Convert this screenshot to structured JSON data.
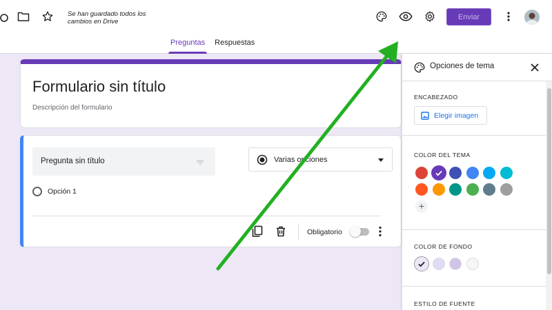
{
  "header": {
    "save_status": "Se han guardado todos los cambios en Drive",
    "send_label": "Enviar"
  },
  "tabs": [
    {
      "label": "Preguntas",
      "active": true
    },
    {
      "label": "Respuestas",
      "active": false
    }
  ],
  "form": {
    "title": "Formulario sin título",
    "description_placeholder": "Descripción del formulario"
  },
  "question": {
    "title_placeholder": "Pregunta sin título",
    "type_label": "Varias opciones",
    "option_label": "Opción 1",
    "required_label": "Obligatorio",
    "required": false
  },
  "theme_panel": {
    "title": "Opciones de tema",
    "header_section": "ENCABEZADO",
    "choose_image_label": "Elegir imagen",
    "theme_color_section": "COLOR DEL TEMA",
    "background_color_section": "COLOR DE FONDO",
    "font_style_section": "ESTILO DE FUENTE",
    "theme_colors": [
      "#db4437",
      "#673ab7",
      "#3f51b5",
      "#4285f4",
      "#03a9f4",
      "#00bcd4",
      "#ff5722",
      "#ff9800",
      "#009688",
      "#4caf50",
      "#607d8b",
      "#9e9e9e"
    ],
    "selected_theme_color": "#673ab7",
    "background_colors": [
      "#ede7f6",
      "#e2daf4",
      "#d1c4e9",
      "#f6f6f6"
    ],
    "selected_background_color": "#ede7f6"
  },
  "colors": {
    "accent": "#673ab7",
    "question_border": "#4285f4",
    "annotation_arrow": "#22b022"
  }
}
